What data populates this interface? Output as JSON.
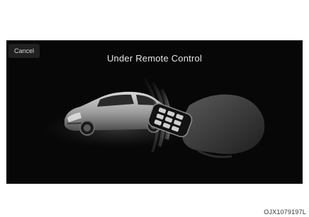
{
  "screen": {
    "cancel_label": "Cancel",
    "title": "Under Remote Control"
  },
  "illustration": {
    "car_icon": "car-icon",
    "hand_icon": "hand-icon",
    "remote_icon": "smart-key-remote-icon",
    "signal_icon": "signal-waves-icon"
  },
  "caption": "OJX1079197L",
  "colors": {
    "screen_background": "#070707",
    "text": "#e6e6e6",
    "button": "#202020"
  }
}
